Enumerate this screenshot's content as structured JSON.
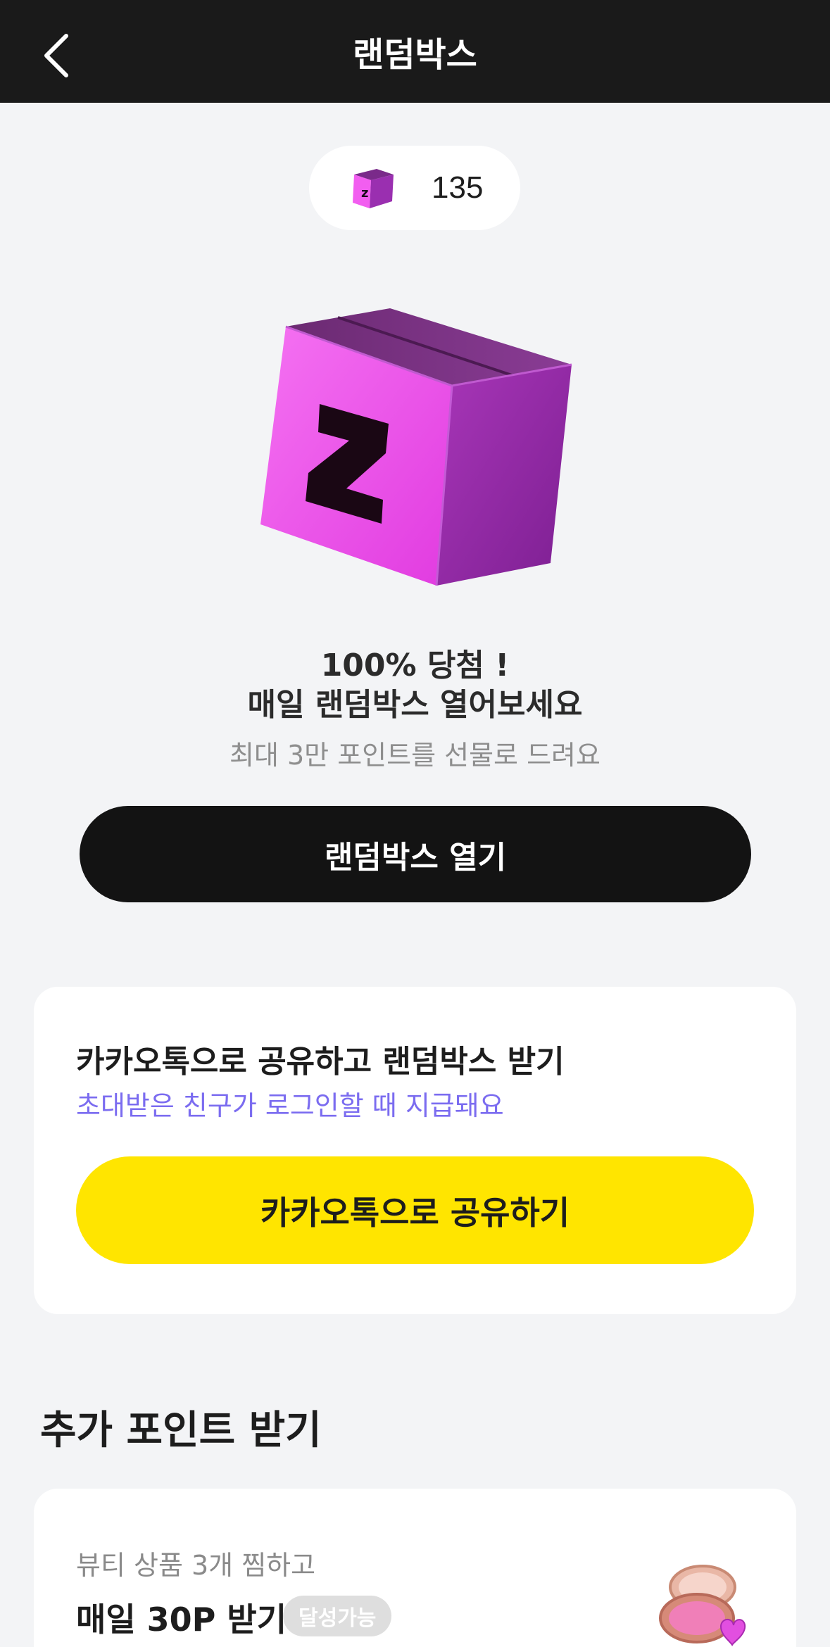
{
  "header": {
    "title": "랜덤박스",
    "back_icon": "chevron-left-icon"
  },
  "points": {
    "icon": "random-box-icon",
    "value": "135"
  },
  "hero": {
    "image": "random-box-illustration",
    "box_letter": "Z",
    "headline_line1": "100% 당첨 !",
    "headline_line2": "매일 랜덤박스 열어보세요",
    "subtext": "최대 3만 포인트를 선물로 드려요",
    "open_button_label": "랜덤박스 열기"
  },
  "share": {
    "title": "카카오톡으로 공유하고 랜덤박스 받기",
    "subtitle": "초대받은 친구가 로그인할 때 지급돼요",
    "button_label": "카카오톡으로 공유하기"
  },
  "extra_points": {
    "section_title": "추가 포인트 받기",
    "missions": [
      {
        "description": "뷰티 상품 3개 찜하고",
        "reward": "매일 30P 받기",
        "badge": "달성가능",
        "image": "blush-compact-icon"
      }
    ]
  },
  "colors": {
    "topbar": "#1a1a1a",
    "background": "#f3f4f6",
    "primary_button": "#131313",
    "kakao_yellow": "#ffe500",
    "accent_purple": "#7b6cf0",
    "box_pink": "#f05cf0",
    "box_purple": "#8e24a8"
  }
}
